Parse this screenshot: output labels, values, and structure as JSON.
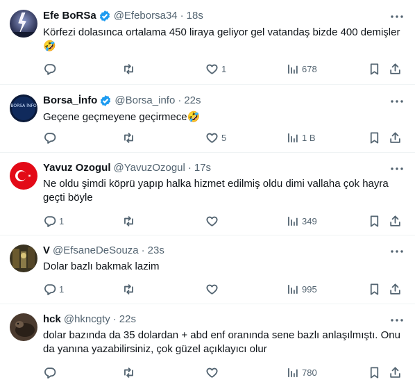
{
  "tweets": [
    {
      "name": "Efe BoRSa",
      "verified": true,
      "handle": "@Efeborsa34",
      "time": "18s",
      "text": "Körfezi dolasınca ortalama 450 liraya geliyor gel vatandaş bizde 400 demişler 🤣",
      "replies": "",
      "retweets": "",
      "likes": "1",
      "views": "678",
      "avatar": "storm-lightning"
    },
    {
      "name": "Borsa_İnfo",
      "verified": true,
      "handle": "@Borsa_info",
      "time": "22s",
      "text": "Geçene geçmeyene geçirmece🤣",
      "replies": "",
      "retweets": "",
      "likes": "5",
      "views": "1 B",
      "avatar": "borsa-info-logo"
    },
    {
      "name": "Yavuz Ozogul",
      "verified": false,
      "handle": "@YavuzOzogul",
      "time": "17s",
      "text": "Ne oldu şimdi köprü yapıp halka hizmet edilmiş oldu dimi vallaha çok hayra geçti böyle",
      "replies": "1",
      "retweets": "",
      "likes": "",
      "views": "349",
      "avatar": "turkish-flag"
    },
    {
      "name": "V",
      "verified": false,
      "handle": "@EfsaneDeSouza",
      "time": "23s",
      "text": "Dolar bazlı bakmak lazim",
      "replies": "1",
      "retweets": "",
      "likes": "",
      "views": "995",
      "avatar": "photo-dark"
    },
    {
      "name": "hck",
      "verified": false,
      "handle": "@hkncgty",
      "time": "22s",
      "text": "dolar bazında da 35 dolardan + abd enf oranında sene bazlı anlaşılmıştı. Onu da yanına yazabilirsiniz, çok güzel açıklayıcı olur",
      "replies": "",
      "retweets": "",
      "likes": "",
      "views": "780",
      "avatar": "animal-dark"
    }
  ],
  "avatar_texts": {
    "borsa_logo": "BORSA İNFO"
  },
  "colors": {
    "text": "#0f1419",
    "muted": "#536471",
    "verified": "#1d9bf0",
    "divider": "#eff3f4"
  }
}
